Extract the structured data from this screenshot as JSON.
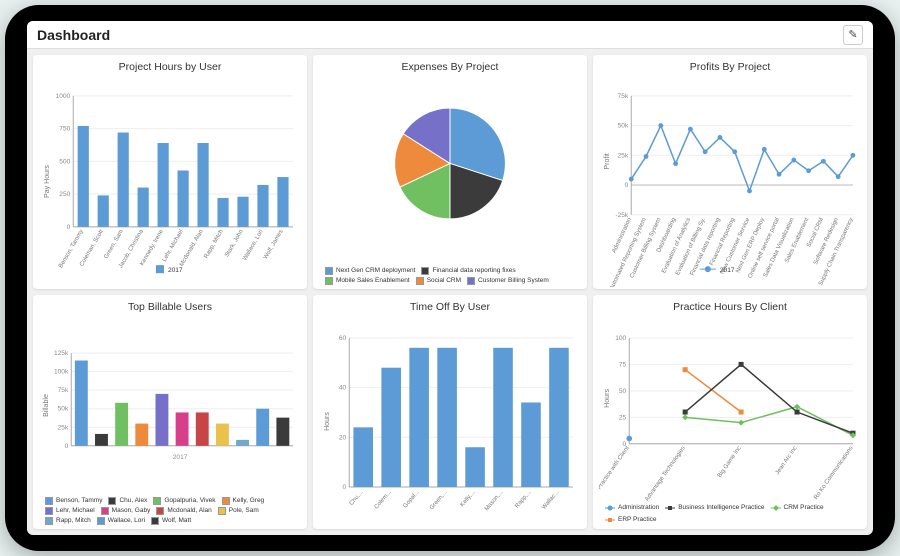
{
  "header": {
    "title": "Dashboard",
    "edit_label": "✎"
  },
  "cards": [
    {
      "title": "Project Hours by User"
    },
    {
      "title": "Expenses By Project"
    },
    {
      "title": "Profits By Project"
    },
    {
      "title": "Top Billable Users"
    },
    {
      "title": "Time Off By User"
    },
    {
      "title": "Practice Hours By Client"
    }
  ],
  "chart_data": [
    {
      "type": "bar",
      "title": "Project Hours by User",
      "ylabel": "Pay Hours",
      "ylim": [
        0,
        1000
      ],
      "yticks": [
        0,
        250,
        500,
        750,
        1000
      ],
      "categories": [
        "Benson, Tammy",
        "Coleman, Scott",
        "Green, Sam",
        "Jacob, Christina",
        "Kennedy, Irene",
        "Lehr, Michael",
        "Mcdonald, Alan",
        "Rapp, Mitch",
        "Stark, John",
        "Wallace, Lori",
        "Wolf, James"
      ],
      "values": [
        770,
        240,
        720,
        300,
        640,
        430,
        640,
        220,
        230,
        320,
        380
      ],
      "legend": [
        "2017"
      ],
      "color": "#5c9bd5"
    },
    {
      "type": "pie",
      "title": "Expenses By Project",
      "series": [
        {
          "name": "Next Gen CRM deployment",
          "value": 30,
          "color": "#5c9bd5"
        },
        {
          "name": "Financial data reporting fixes",
          "value": 20,
          "color": "#3b3b3b"
        },
        {
          "name": "Mobile Sales Enablement",
          "value": 18,
          "color": "#70c062"
        },
        {
          "name": "Social CRM",
          "value": 16,
          "color": "#ee8a3b"
        },
        {
          "name": "Customer Billing System",
          "value": 16,
          "color": "#7670c8"
        }
      ]
    },
    {
      "type": "line",
      "title": "Profits By Project",
      "ylabel": "Profit",
      "ylim": [
        -25000,
        75000
      ],
      "yticks": [
        -25000,
        0,
        25000,
        50000,
        75000
      ],
      "ytick_labels": [
        "-25k",
        "0",
        "25k",
        "50k",
        "75k"
      ],
      "categories": [
        "Administration",
        "Automated Reporting System",
        "Customer Billing System",
        "Dashboarding",
        "Evaluation of Analytics",
        "Evaluation of Billing Sy.",
        "Financial data reporting",
        "Financial Reporting",
        "New Customer Service",
        "Next Gen ERP Deploy",
        "Online self service portal",
        "Sales Data Visualization",
        "Sales Enablement",
        "Social CRM",
        "Software Redesign",
        "Supply Chain Transparency"
      ],
      "values": [
        5000,
        24000,
        50000,
        18000,
        47000,
        28000,
        40000,
        28000,
        -5000,
        30000,
        9000,
        21000,
        12000,
        20000,
        7000,
        25000
      ],
      "legend": [
        "2017"
      ],
      "color": "#5c9bd5"
    },
    {
      "type": "bar",
      "title": "Top Billable Users",
      "ylabel": "Billable",
      "ylim": [
        0,
        125000
      ],
      "yticks": [
        0,
        25000,
        50000,
        75000,
        100000,
        125000
      ],
      "ytick_labels": [
        "0",
        "25k",
        "50k",
        "75k",
        "100k",
        "125k"
      ],
      "xlabel": "2017",
      "categories": [
        "Benson, Tammy",
        "Chu, Alex",
        "Gopalpuria, Vivek",
        "Kelly, Greg",
        "Lehr, Michael",
        "Mason, Gaby",
        "Mcdonald, Alan",
        "Pole, Sam",
        "Rapp, Mitch",
        "Wallace, Lori",
        "Wolf, Matt"
      ],
      "values": [
        115000,
        16000,
        58000,
        30000,
        70000,
        45000,
        45000,
        30000,
        8000,
        50000,
        38000
      ],
      "colors": [
        "#5c9bd5",
        "#3b3b3b",
        "#70c062",
        "#ee8a3b",
        "#7670c8",
        "#d83f8b",
        "#c74545",
        "#e8c24a",
        "#6fa8c8",
        "#5c9bd5",
        "#3b3b3b"
      ]
    },
    {
      "type": "bar",
      "title": "Time Off By User",
      "ylabel": "Hours",
      "ylim": [
        0,
        60
      ],
      "yticks": [
        0,
        20,
        40,
        60
      ],
      "categories": [
        "Chu,...",
        "Colem...",
        "Gopal...",
        "Green,...",
        "Kelly,...",
        "Mason,...",
        "Rapp,...",
        "Wallac..."
      ],
      "values": [
        24,
        48,
        56,
        56,
        16,
        56,
        34,
        56
      ],
      "color": "#5c9bd5"
    },
    {
      "type": "line",
      "title": "Practice Hours By Client",
      "ylabel": "Hours",
      "ylim": [
        0,
        100
      ],
      "yticks": [
        0,
        25,
        50,
        75,
        100
      ],
      "categories": [
        "No Client Practice with Client",
        "Advantage Technologies",
        "Big Game Inc",
        "Jean Arc Inc",
        "Ro Ko Communications"
      ],
      "series": [
        {
          "name": "Administration",
          "values": [
            5,
            null,
            null,
            null,
            null
          ],
          "color": "#5c9bd5"
        },
        {
          "name": "Business Intelligence Practice",
          "values": [
            null,
            30,
            75,
            30,
            10
          ],
          "color": "#3b3b3b"
        },
        {
          "name": "CRM Practice",
          "values": [
            null,
            25,
            20,
            35,
            8
          ],
          "color": "#70c062"
        },
        {
          "name": "ERP Practice",
          "values": [
            null,
            70,
            30,
            null,
            null
          ],
          "color": "#ee8a3b"
        }
      ]
    }
  ]
}
